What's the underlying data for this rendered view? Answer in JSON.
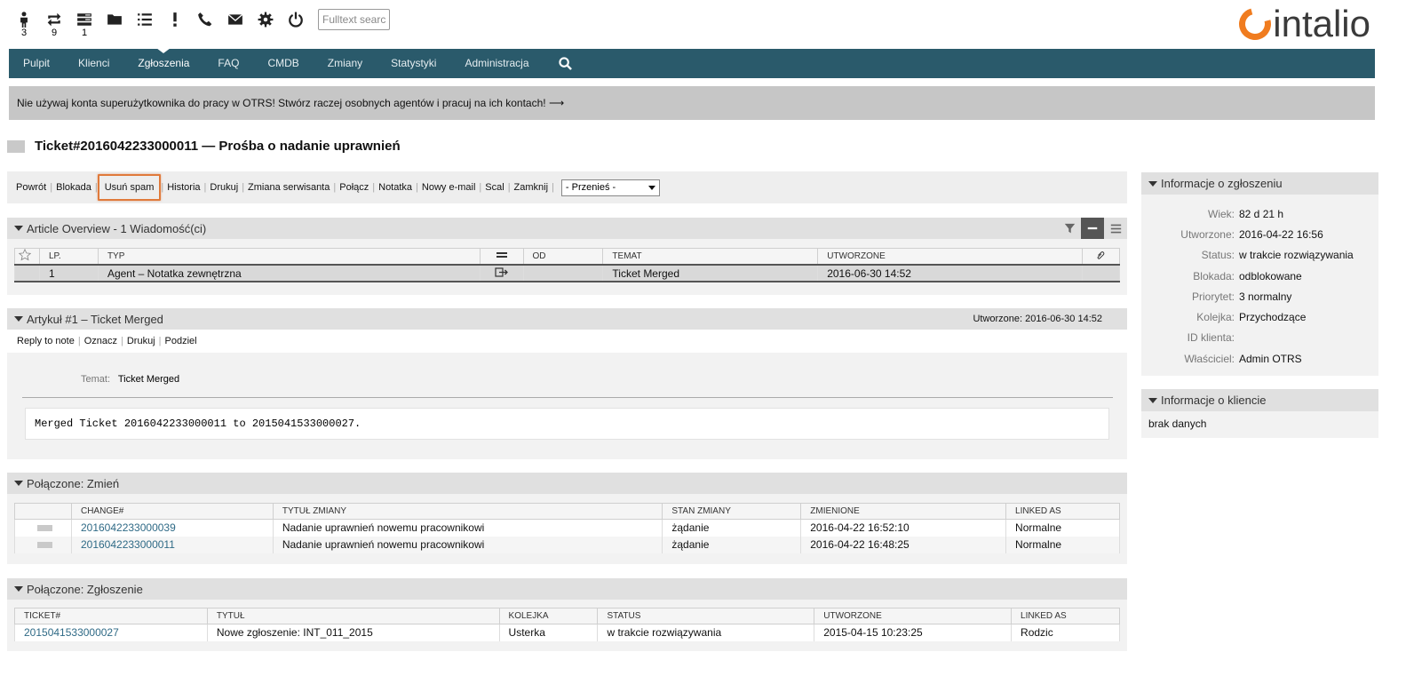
{
  "toolbar": {
    "items": [
      {
        "icon": "person-icon",
        "count": "3"
      },
      {
        "icon": "repeat-icon",
        "count": "9"
      },
      {
        "icon": "list-responsible-icon",
        "count": "1"
      },
      {
        "icon": "folder-icon",
        "count": ""
      },
      {
        "icon": "list-icon",
        "count": ""
      },
      {
        "icon": "exclamation-icon",
        "count": ""
      },
      {
        "icon": "phone-icon",
        "count": ""
      },
      {
        "icon": "envelope-icon",
        "count": ""
      },
      {
        "icon": "gear-icon",
        "count": ""
      },
      {
        "icon": "power-icon",
        "count": ""
      }
    ],
    "fulltext_placeholder": "Fulltext search"
  },
  "logo": {
    "word": "intalio",
    "accent": "#f07c1f"
  },
  "nav": {
    "items": [
      "Pulpit",
      "Klienci",
      "Zgłoszenia",
      "FAQ",
      "CMDB",
      "Zmiany",
      "Statystyki",
      "Administracja"
    ],
    "active": "Zgłoszenia",
    "bg": "#2a5a6b"
  },
  "notice": "Nie używaj konta superużytkownika do pracy w OTRS! Stwórz raczej osobnych agentów i pracuj na ich kontach! ⟶",
  "ticket_title": "Ticket#2016042233000011 — Prośba o nadanie uprawnień",
  "actions": {
    "items": [
      "Powrót",
      "Blokada",
      "Usuń spam",
      "Historia",
      "Drukuj",
      "Zmiana serwisanta",
      "Połącz",
      "Notatka",
      "Nowy e-mail",
      "Scal",
      "Zamknij"
    ],
    "move_selected": "- Przenieś -"
  },
  "overview": {
    "title": "Article Overview - 1 Wiadomość(ci)",
    "headers": [
      "LP.",
      "TYP",
      "OD",
      "TEMAT",
      "UTWORZONE"
    ],
    "rows": [
      {
        "num": "1",
        "type": "Agent – Notatka zewnętrzna",
        "from": "",
        "subject": "Ticket Merged",
        "created": "2016-06-30 14:52"
      }
    ]
  },
  "article": {
    "title": "Artykuł #1 – Ticket Merged",
    "created": "Utworzone: 2016-06-30 14:52",
    "actions": [
      "Reply to note",
      "Oznacz",
      "Drukuj",
      "Podziel"
    ],
    "subject_label": "Temat:",
    "subject": "Ticket Merged",
    "body": "Merged Ticket 2016042233000011 to 2015041533000027."
  },
  "changes": {
    "title": "Połączone: Zmień",
    "headers": [
      "CHANGE#",
      "TYTUŁ ZMIANY",
      "STAN ZMIANY",
      "ZMIENIONE",
      "LINKED AS"
    ],
    "rows": [
      {
        "num": "2016042233000039",
        "title": "Nadanie uprawnień nowemu pracownikowi",
        "state": "żądanie",
        "changed": "2016-04-22 16:52:10",
        "linked": "Normalne"
      },
      {
        "num": "2016042233000011",
        "title": "Nadanie uprawnień nowemu pracownikowi",
        "state": "żądanie",
        "changed": "2016-04-22 16:48:25",
        "linked": "Normalne"
      }
    ]
  },
  "tickets": {
    "title": "Połączone: Zgłoszenie",
    "headers": [
      "TICKET#",
      "TYTUŁ",
      "KOLEJKA",
      "STATUS",
      "UTWORZONE",
      "LINKED AS"
    ],
    "rows": [
      {
        "num": "2015041533000027",
        "title": "Nowe zgłoszenie: INT_011_2015",
        "queue": "Usterka",
        "status": "w trakcie rozwiązywania",
        "created": "2015-04-15 10:23:25",
        "linked": "Rodzic"
      }
    ]
  },
  "ticket_info": {
    "title": "Informacje o zgłoszeniu",
    "rows": [
      {
        "k": "Wiek:",
        "v": "82 d 21 h"
      },
      {
        "k": "Utworzone:",
        "v": "2016-04-22 16:56"
      },
      {
        "k": "Status:",
        "v": "w trakcie rozwiązywania"
      },
      {
        "k": "Blokada:",
        "v": "odblokowane"
      },
      {
        "k": "Priorytet:",
        "v": "3 normalny"
      },
      {
        "k": "Kolejka:",
        "v": "Przychodzące"
      },
      {
        "k": "ID klienta:",
        "v": ""
      },
      {
        "k": "Właściciel:",
        "v": "Admin OTRS"
      }
    ]
  },
  "client_info": {
    "title": "Informacje o kliencie",
    "empty": "brak danych"
  }
}
